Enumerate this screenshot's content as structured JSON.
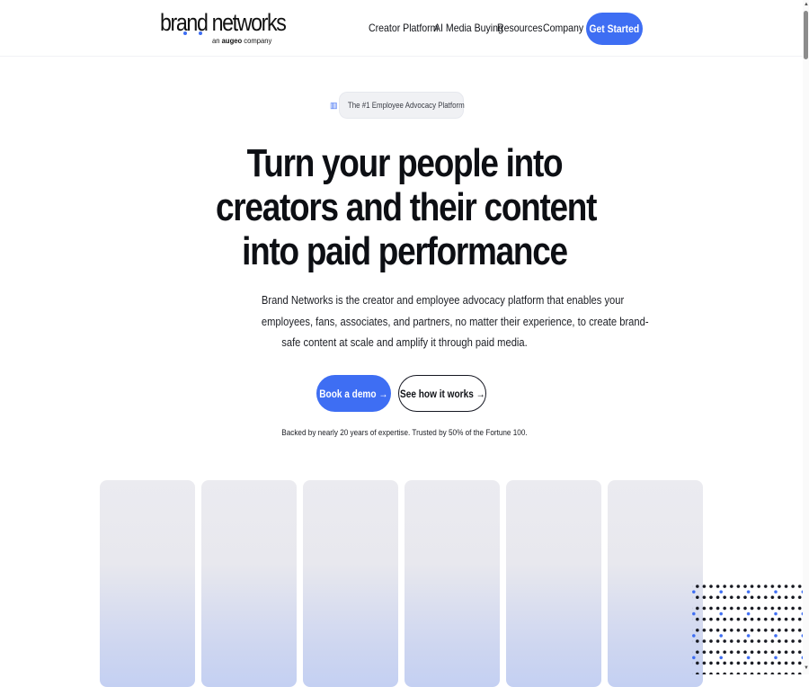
{
  "header": {
    "logo": {
      "text": "brand networks",
      "sub_prefix": "an ",
      "sub_brand": "augeo",
      "sub_suffix": " company"
    },
    "nav": [
      "Creator Platform",
      "AI Media Buying",
      "Resources",
      "Company"
    ],
    "cta_label": "Get Started"
  },
  "hero": {
    "badge_icon": "building-icon",
    "badge_text": "The #1 Employee Advocacy Platform",
    "title_lines": [
      "Turn your people into",
      "creators and their content",
      "into paid performance"
    ],
    "description_lines": [
      "Brand Networks is the creator and employee advocacy platform that enables your",
      "employees, fans, associates, and partners, no matter their experience, to create brand-",
      "safe content at scale and amplify it through paid media."
    ],
    "primary_button": "Book a demo →",
    "secondary_button": "See how it works →",
    "trust_text": "Backed by nearly 20 years of expertise. Trusted by 50% of the Fortune 100."
  },
  "colors": {
    "accent": "#3e6ef3",
    "text": "#111318",
    "card_top": "#ebebf0",
    "card_bottom": "#c4d0f2"
  },
  "scrollbar": {
    "up_arrow": "▲",
    "down_arrow": "▼"
  }
}
